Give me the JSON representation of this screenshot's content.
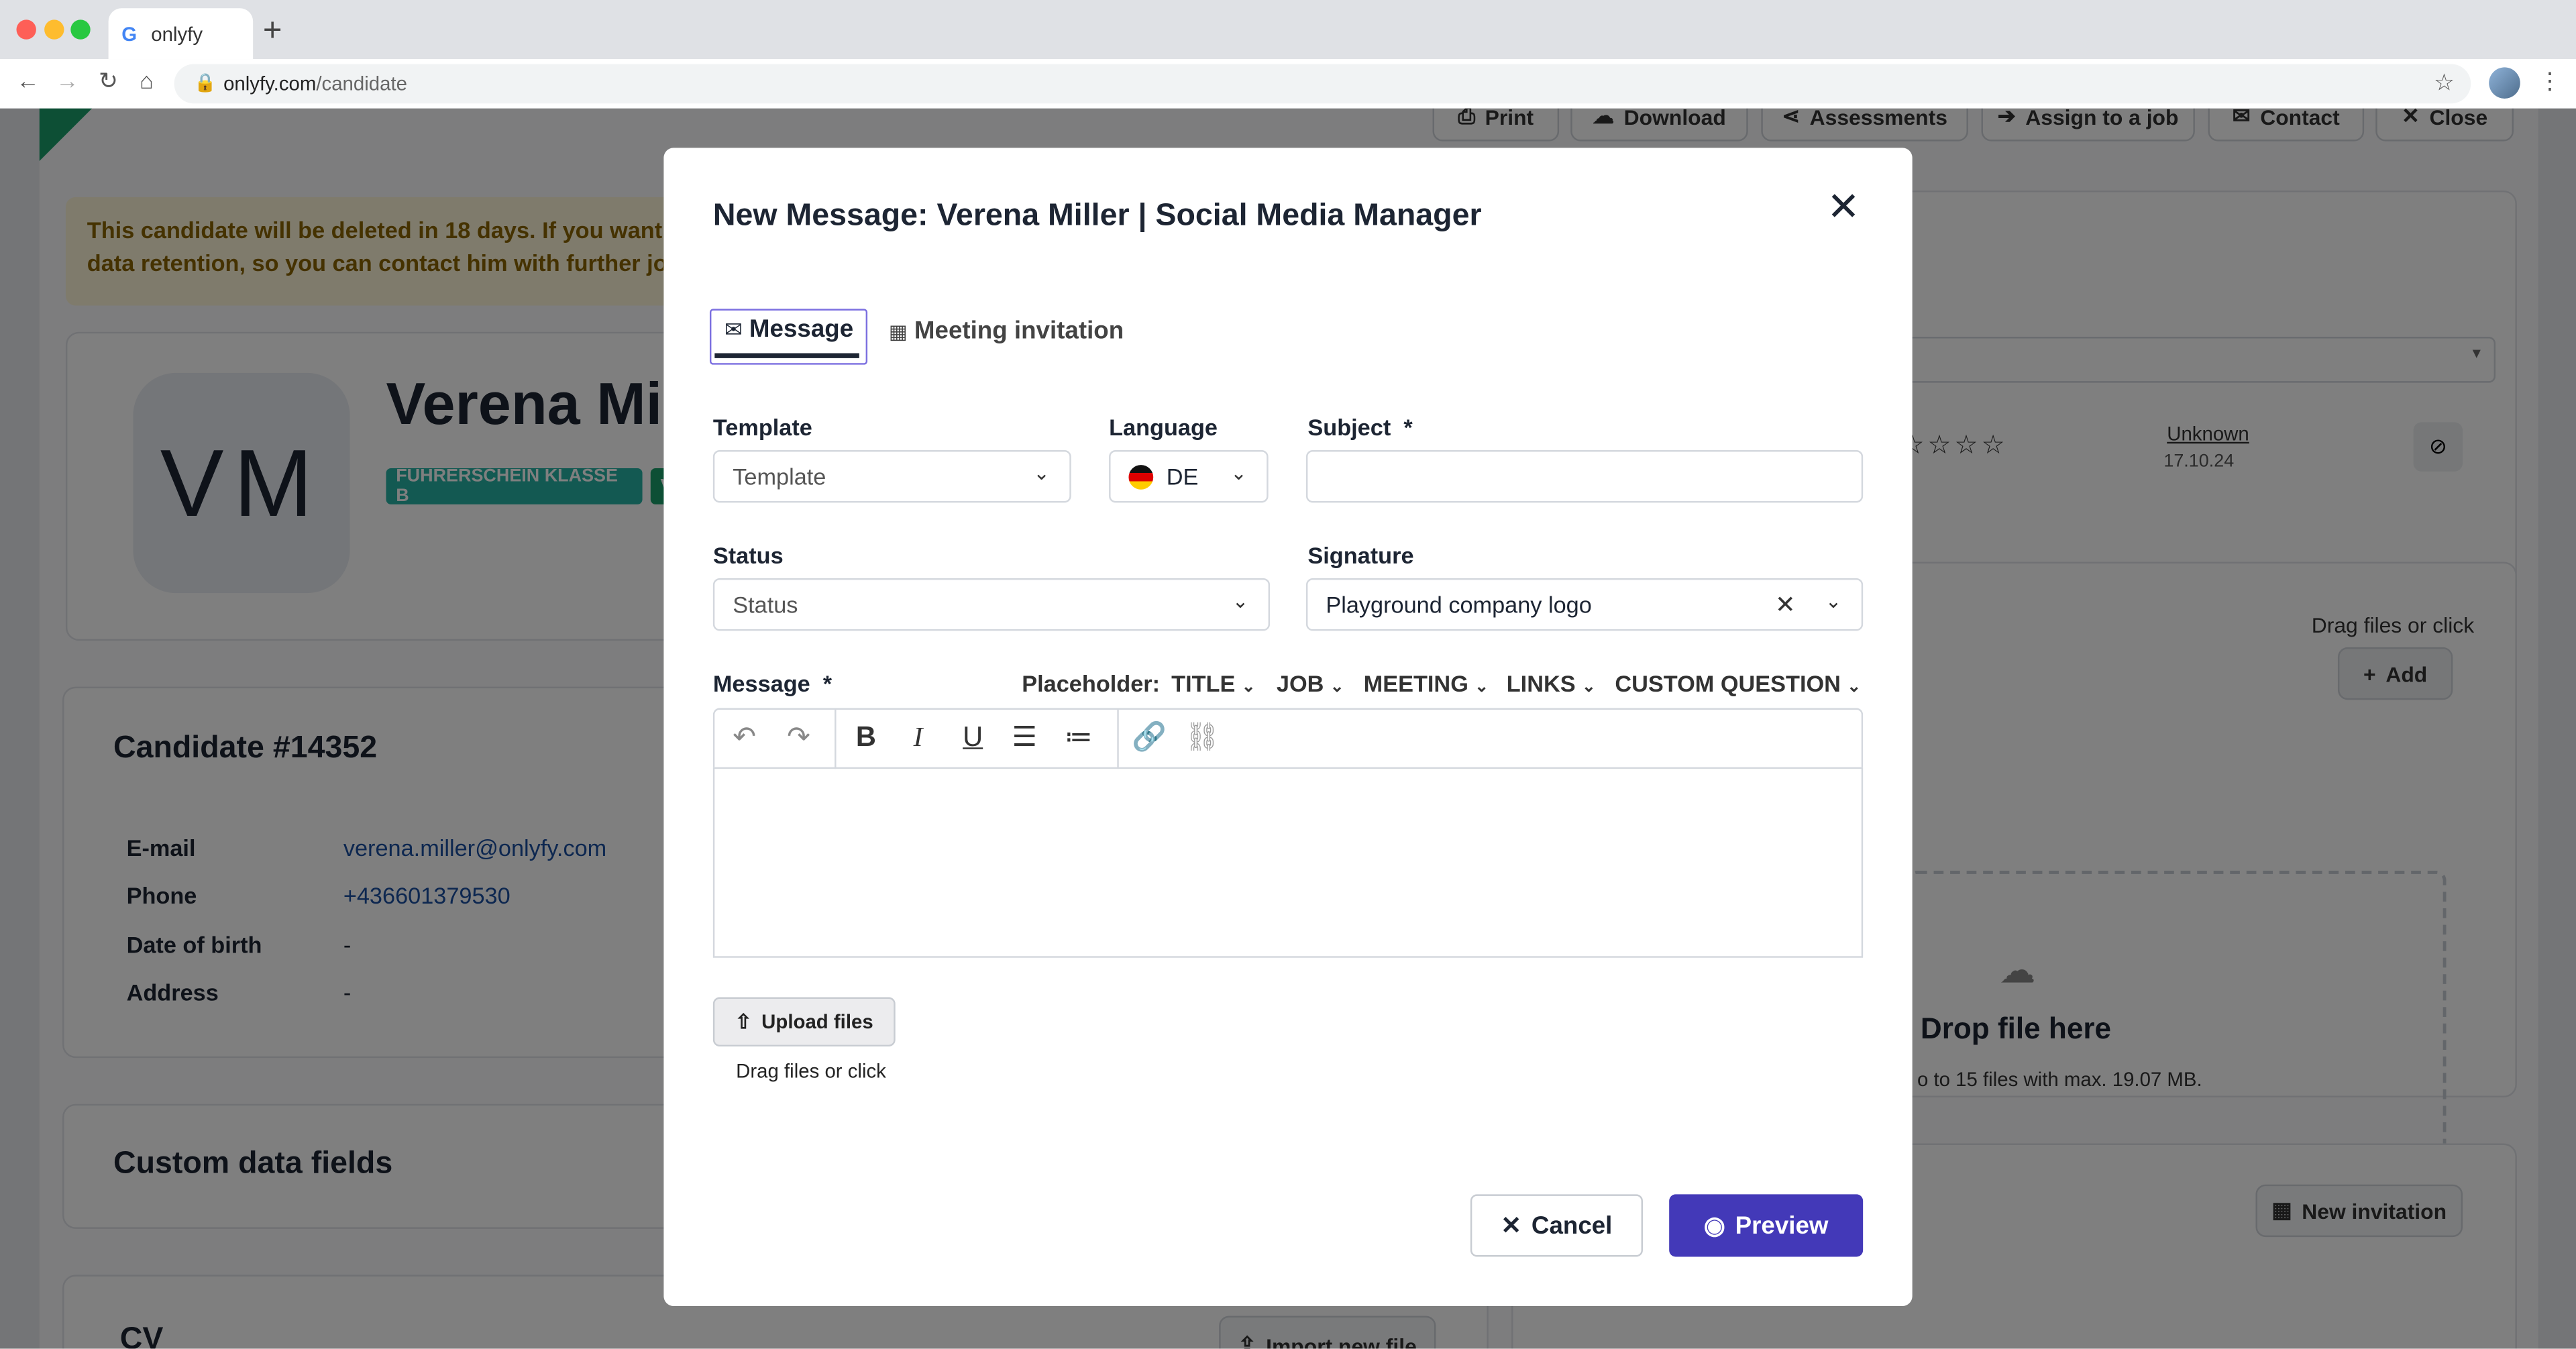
{
  "browser": {
    "tab_title": "onlyfy",
    "favicon": "G",
    "new_tab": "+",
    "url_host": "onlyfy.com",
    "url_path": "/candidate"
  },
  "background": {
    "actions": {
      "print": "Print",
      "download": "Download",
      "assessments": "Assessments",
      "assign": "Assign to a job",
      "contact": "Contact",
      "close": "Close"
    },
    "warning_line1": "This candidate will be deleted in 18 days. If you want to",
    "warning_line2": "data retention, so you can contact him with further job",
    "avatar_initials": "VM",
    "candidate_name": "Verena Miller",
    "badges": [
      "FÜHRERSCHEIN KLASSE B",
      "V"
    ],
    "details_title": "Candidate #14352",
    "details": [
      {
        "key": "E-mail",
        "value": "verena.miller@onlyfy.com"
      },
      {
        "key": "Phone",
        "value": "+436601379530"
      },
      {
        "key": "Date of birth",
        "value": "-"
      },
      {
        "key": "Address",
        "value": "-"
      }
    ],
    "custom_fields_title": "Custom data fields",
    "cv_title": "CV",
    "import_label": "Import new file",
    "rating_source": "Unknown",
    "rating_date": "17.10.24",
    "drag_label": "Drag files or click",
    "add_label": "Add",
    "drop_title": "Drop file here",
    "drop_hint": "o to 15 files with max. 19.07 MB.",
    "new_invitation": "New invitation"
  },
  "modal": {
    "title": "New Message: Verena Miller | Social Media Manager",
    "tabs": {
      "message": "Message",
      "meeting": "Meeting invitation"
    },
    "template": {
      "label": "Template",
      "placeholder": "Template"
    },
    "language": {
      "label": "Language",
      "value": "DE"
    },
    "subject": {
      "label": "Subject",
      "required": "*",
      "value": ""
    },
    "status": {
      "label": "Status",
      "placeholder": "Status"
    },
    "signature": {
      "label": "Signature",
      "value": "Playground company logo"
    },
    "message": {
      "label": "Message",
      "required": "*"
    },
    "placeholder_label": "Placeholder:",
    "placeholder_menus": [
      "TITLE",
      "JOB",
      "MEETING",
      "LINKS",
      "CUSTOM QUESTION"
    ],
    "upload_label": "Upload files",
    "upload_hint": "Drag files or click",
    "cancel": "Cancel",
    "preview": "Preview"
  },
  "colors": {
    "primary": "#4339b8",
    "badge": "#27b3a4",
    "warning_bg": "#fff6d9",
    "link": "#1a4fa0"
  }
}
